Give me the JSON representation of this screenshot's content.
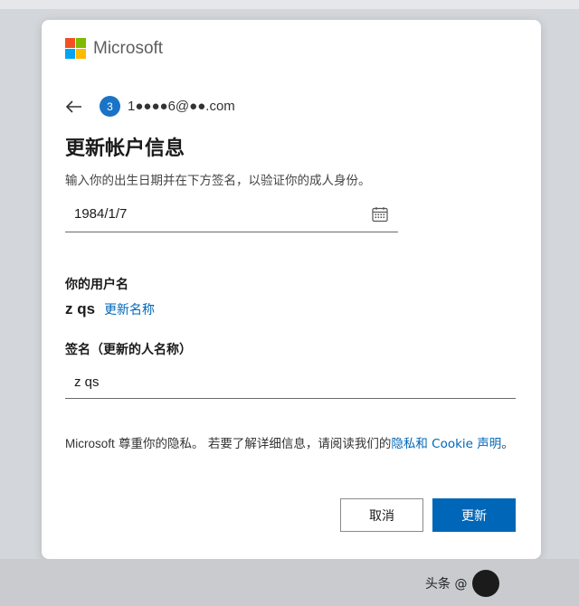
{
  "brand": {
    "name": "Microsoft",
    "logo_colors": [
      "#f25022",
      "#7fba00",
      "#00a4ef",
      "#ffb900"
    ]
  },
  "account": {
    "avatar_text": "3",
    "email": "1●●●●6@●●.com"
  },
  "page": {
    "title": "更新帐户信息",
    "instruction": "输入你的出生日期并在下方签名，以验证你的成人身份。"
  },
  "birthdate": {
    "value": "1984/1/7"
  },
  "username_section": {
    "label": "你的用户名",
    "value": "z qs",
    "update_link": "更新名称"
  },
  "signature": {
    "label": "签名（更新的人名称）",
    "value": "z qs"
  },
  "privacy": {
    "prefix": "Microsoft",
    "text": " 尊重你的隐私。 若要了解详细信息，请阅读我们的",
    "link": "隐私和 Cookie 声明",
    "suffix": "。"
  },
  "buttons": {
    "cancel": "取消",
    "update": "更新"
  },
  "watermark": {
    "text": "头条 @"
  },
  "colors": {
    "accent": "#0067b8",
    "avatar": "#1a73c6"
  }
}
